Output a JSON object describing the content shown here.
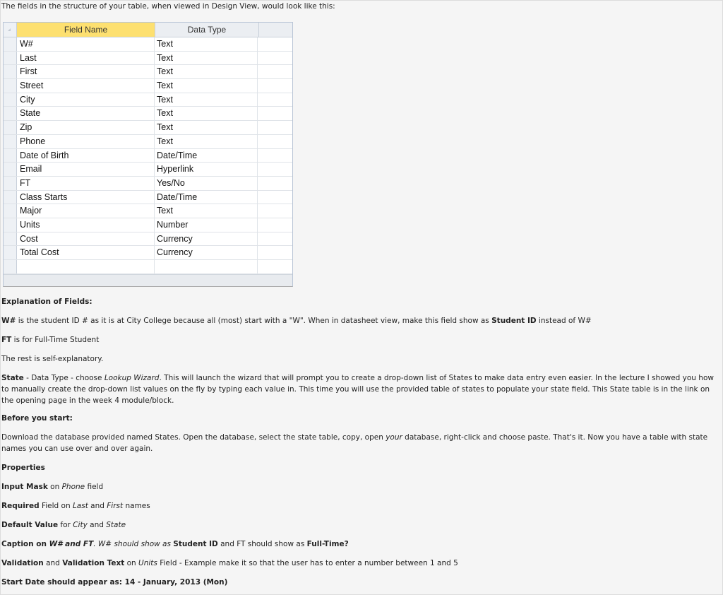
{
  "intro": "The fields in the structure of your table, when viewed in Design View, would look like this:",
  "design_view": {
    "headers": {
      "field_name": "Field Name",
      "data_type": "Data Type"
    },
    "rows": [
      {
        "field": "W#",
        "type": "Text"
      },
      {
        "field": "Last",
        "type": "Text"
      },
      {
        "field": "First",
        "type": "Text"
      },
      {
        "field": "Street",
        "type": "Text"
      },
      {
        "field": "City",
        "type": "Text"
      },
      {
        "field": "State",
        "type": "Text"
      },
      {
        "field": "Zip",
        "type": "Text"
      },
      {
        "field": "Phone",
        "type": "Text"
      },
      {
        "field": "Date of Birth",
        "type": "Date/Time"
      },
      {
        "field": "Email",
        "type": "Hyperlink"
      },
      {
        "field": "FT",
        "type": "Yes/No"
      },
      {
        "field": "Class Starts",
        "type": "Date/Time"
      },
      {
        "field": "Major",
        "type": "Text"
      },
      {
        "field": "Units",
        "type": "Number"
      },
      {
        "field": "Cost",
        "type": "Currency"
      },
      {
        "field": "Total Cost",
        "type": "Currency"
      },
      {
        "field": "",
        "type": ""
      },
      {
        "field": "",
        "type": ""
      }
    ]
  },
  "explanation": {
    "heading": "Explanation of Fields:",
    "w_label": "W#",
    "w_text_1": " is the student ID # as it is at City College because all (most) start with a \"W\". When in datasheet view, make this field show as ",
    "w_student_id": "Student ID",
    "w_text_2": " instead of W#",
    "ft_label": "FT",
    "ft_text": " is for Full-Time Student",
    "rest": "The rest is self-explanatory.",
    "state_label": "State",
    "state_text_1": " - Data Type - choose ",
    "state_lookup": "Lookup Wizard",
    "state_text_2": ". This will launch the wizard that will prompt you to create a drop-down list of States to make data entry even easier. In the lecture I showed you how to manually create the drop-down list values on the fly by typing each value in. This time you will use the provided table of states to populate your state field. This State table is in the link on the opening page in the week 4 module/block."
  },
  "before_start": {
    "heading": "Before you start:",
    "text_1": "Download the database provided named States. Open the database, select the state table, copy, open ",
    "your": "your",
    "text_2": " database, right-click and choose paste. That's it. Now you have a table with state names you can use over and over again."
  },
  "properties": {
    "heading": "Properties",
    "input_mask": "Input Mask",
    "input_mask_on": " on ",
    "phone": "Phone",
    "field": " field",
    "required": "Required",
    "required_on": " Field on ",
    "last": "Last",
    "and": " and ",
    "first": "First",
    "names": " names",
    "default_value": "Default Value",
    "for": " for ",
    "city": "City",
    "and2": " and ",
    "state": "State",
    "caption_on": "Caption on ",
    "caption_fields": "W# and FT",
    "caption_text": ". W# should show as ",
    "caption_student_id": "Student ID",
    "caption_text_2": " and FT should show as ",
    "caption_fulltime": "Full-Time?",
    "validation": "Validation",
    "validation_and": " and ",
    "validation_text": "Validation Text",
    "validation_on": " on ",
    "units_field": "Units",
    "validation_rest": " Field - Example make it so that the user has to enter a number between 1 and 5",
    "start_date": "Start Date should appear as: 14 - January, 2013 (Mon)"
  }
}
